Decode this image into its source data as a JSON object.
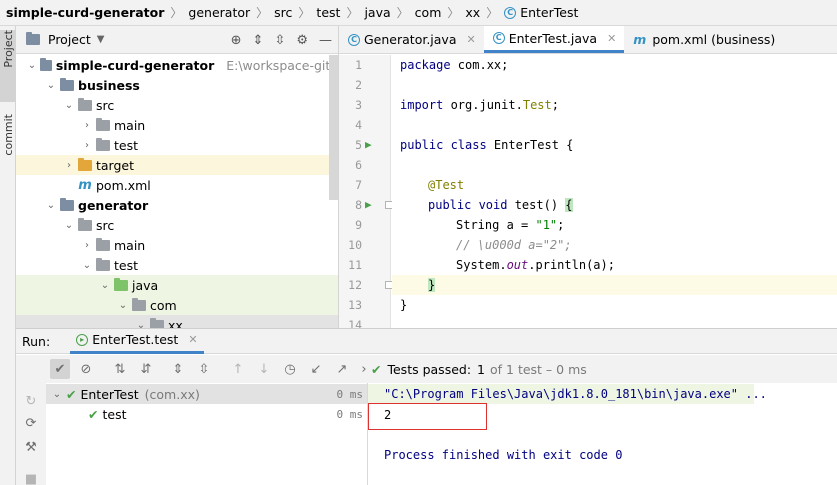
{
  "breadcrumb": [
    "simple-curd-generator",
    "generator",
    "src",
    "test",
    "java",
    "com",
    "xx",
    "EnterTest"
  ],
  "left_stripe": {
    "project_label": "Project",
    "commit_label": "commit"
  },
  "project_panel": {
    "title": "Project",
    "tree": [
      {
        "label": "simple-curd-generator",
        "note": "E:\\workspace-gite",
        "icon": "module-folder-icon",
        "depth": 0,
        "expanded": true,
        "bold": true
      },
      {
        "label": "business",
        "icon": "module-folder-icon",
        "depth": 1,
        "expanded": true,
        "bold": true
      },
      {
        "label": "src",
        "icon": "folder-icon",
        "depth": 2,
        "expanded": true
      },
      {
        "label": "main",
        "icon": "folder-icon",
        "depth": 3,
        "expanded": false
      },
      {
        "label": "test",
        "icon": "folder-icon",
        "depth": 3,
        "expanded": false
      },
      {
        "label": "target",
        "icon": "excluded-folder-icon",
        "depth": 2,
        "expanded": false
      },
      {
        "label": "pom.xml",
        "icon": "maven-icon",
        "depth": 2
      },
      {
        "label": "generator",
        "icon": "module-folder-icon",
        "depth": 1,
        "expanded": true,
        "bold": true
      },
      {
        "label": "src",
        "icon": "folder-icon",
        "depth": 2,
        "expanded": true
      },
      {
        "label": "main",
        "icon": "folder-icon",
        "depth": 3,
        "expanded": false
      },
      {
        "label": "test",
        "icon": "folder-icon",
        "depth": 3,
        "expanded": true
      },
      {
        "label": "java",
        "icon": "test-folder-icon",
        "depth": 4,
        "expanded": true
      },
      {
        "label": "com",
        "icon": "package-icon",
        "depth": 5,
        "expanded": true
      },
      {
        "label": "xx",
        "icon": "package-icon",
        "depth": 6,
        "expanded": true
      }
    ]
  },
  "editor": {
    "tabs": [
      {
        "label": "Generator.java",
        "icon": "class-icon",
        "active": false
      },
      {
        "label": "EnterTest.java",
        "icon": "class-icon",
        "active": true
      },
      {
        "label": "pom.xml (business)",
        "icon": "maven-icon",
        "active": false
      }
    ],
    "line_numbers": [
      "1",
      "2",
      "3",
      "4",
      "5",
      "6",
      "7",
      "8",
      "9",
      "10",
      "11",
      "12",
      "13",
      "14"
    ],
    "code": {
      "l1_kw": "package",
      "l1_rest": " com.xx;",
      "l3_kw": "import",
      "l3_pkg": " org.junit.",
      "l3_cls": "Test",
      "l3_end": ";",
      "l5_kw": "public class",
      "l5_rest": " EnterTest {",
      "l7_ann": "@Test",
      "l8_kw": "public void",
      "l8_rest": " test() ",
      "l8_brace": "{",
      "l9_pre": "String a = ",
      "l9_str": "\"1\"",
      "l9_end": ";",
      "l10_cmt": "// \\u000d a=\"2\";",
      "l11_pre": "System.",
      "l11_fld": "out",
      "l11_end": ".println(a);",
      "l12_brace": "}",
      "l13_brace": "}"
    }
  },
  "run": {
    "label": "Run:",
    "tab_label": "EnterTest.test",
    "status": {
      "passed": "Tests passed:",
      "count": "1",
      "rest": "of 1 test – 0 ms"
    },
    "test_tree": [
      {
        "label": "EnterTest",
        "note": "(com.xx)",
        "time": "0 ms"
      },
      {
        "label": "test",
        "time": "0 ms"
      }
    ],
    "console": {
      "command": "\"C:\\Program Files\\Java\\jdk1.8.0_181\\bin\\java.exe\" ...",
      "output": "2",
      "exit": "Process finished with exit code 0"
    }
  },
  "colors": {
    "accent": "#4083c9",
    "pass_green": "#4aa049",
    "highlight_box": "#e03131",
    "keyword": "#000080"
  }
}
